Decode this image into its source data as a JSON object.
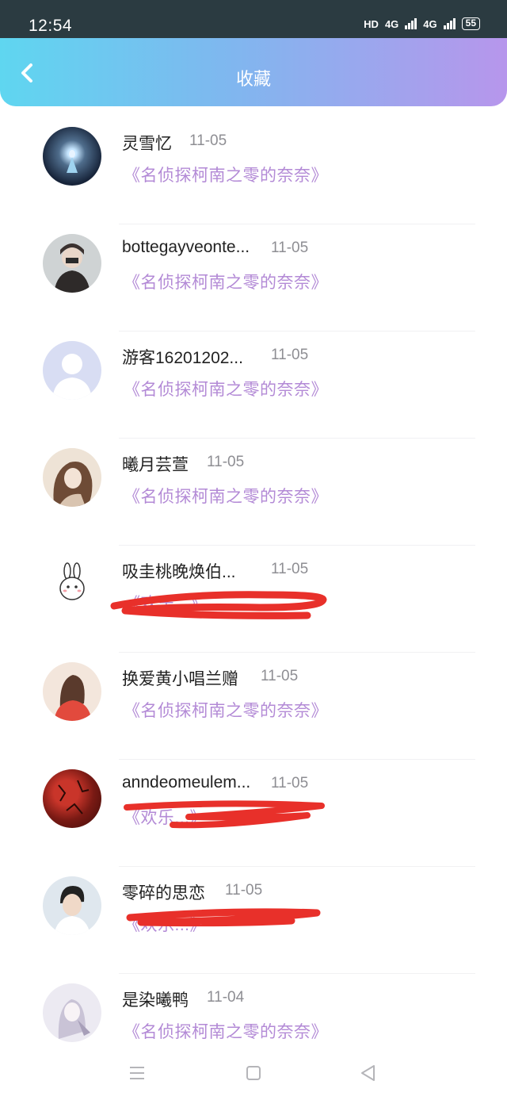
{
  "status": {
    "time": "12:54",
    "hd": "HD",
    "net1": "4G",
    "net2": "4G",
    "battery": "55"
  },
  "header": {
    "title": "收藏"
  },
  "items": [
    {
      "name": "灵雪忆",
      "date": "11-05",
      "subtitle": "《名侦探柯南之零的奈奈》",
      "redacted": false
    },
    {
      "name": "bottegayveonte...",
      "date": "11-05",
      "subtitle": "《名侦探柯南之零的奈奈》",
      "redacted": false
    },
    {
      "name": "游客16201202...",
      "date": "11-05",
      "subtitle": "《名侦探柯南之零的奈奈》",
      "redacted": false
    },
    {
      "name": "曦月芸萱",
      "date": "11-05",
      "subtitle": "《名侦探柯南之零的奈奈》",
      "redacted": false
    },
    {
      "name": "吸圭桃晚焕伯...",
      "date": "11-05",
      "subtitle": "《欢乐...》",
      "redacted": true
    },
    {
      "name": "换爱黄小唱兰赠",
      "date": "11-05",
      "subtitle": "《名侦探柯南之零的奈奈》",
      "redacted": false
    },
    {
      "name": "anndeomeulem...",
      "date": "11-05",
      "subtitle": "《欢乐...》",
      "redacted": true
    },
    {
      "name": "零碎的思恋",
      "date": "11-05",
      "subtitle": "《欢乐...》",
      "redacted": true
    },
    {
      "name": "是染曦鸭",
      "date": "11-04",
      "subtitle": "《名侦探柯南之零的奈奈》",
      "redacted": false
    }
  ],
  "colors": {
    "accent_start": "#5fd6f0",
    "accent_end": "#b796ec",
    "subtitle": "#b38ad6",
    "redaction": "#e8302a"
  },
  "icons": {
    "back": "back-arrow-icon",
    "menu": "menu-icon",
    "home": "home-icon",
    "back_nav": "back-triangle-icon"
  }
}
